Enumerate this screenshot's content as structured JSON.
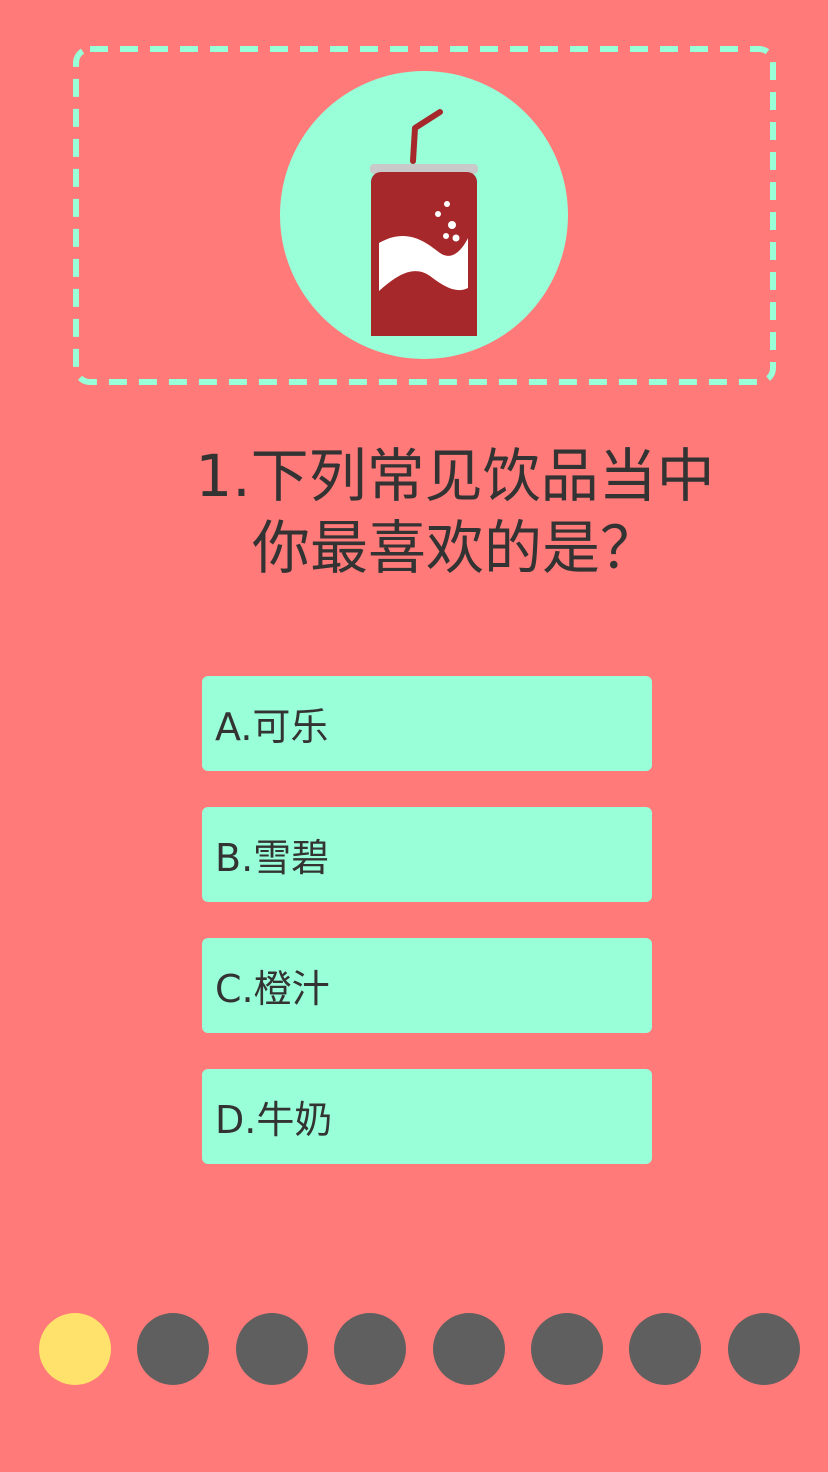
{
  "hero": {
    "icon": "soda-can-icon",
    "frame_color": "#99ffd8",
    "circle_color": "#99ffd8"
  },
  "question": {
    "line1": "1.下列常见饮品当中",
    "line2": "你最喜欢的是？"
  },
  "options": [
    {
      "label": "A.可乐"
    },
    {
      "label": "B.雪碧"
    },
    {
      "label": "C.橙汁"
    },
    {
      "label": "D.牛奶"
    }
  ],
  "progress": {
    "total": 8,
    "current": 1,
    "active_color": "#ffe26b",
    "inactive_color": "#5f5f5f"
  },
  "colors": {
    "background": "#ff7a78",
    "accent": "#99ffd8",
    "text": "#333333"
  }
}
